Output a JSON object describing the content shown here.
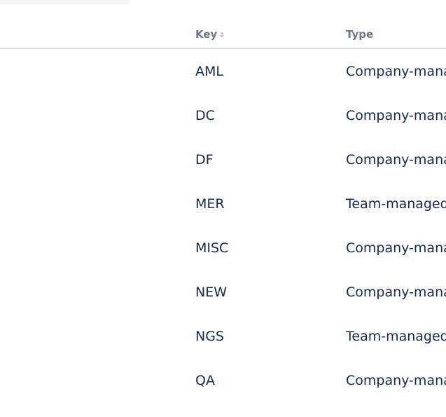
{
  "table": {
    "columns": {
      "key": "Key",
      "type": "Type"
    },
    "rows": [
      {
        "key": "AML",
        "type": "Company-mana"
      },
      {
        "key": "DC",
        "type": "Company-mana"
      },
      {
        "key": "DF",
        "type": "Company-mana"
      },
      {
        "key": "MER",
        "type": "Team-managed"
      },
      {
        "key": "MISC",
        "type": "Company-mana"
      },
      {
        "key": "NEW",
        "type": "Company-mana"
      },
      {
        "key": "NGS",
        "type": "Team-managed"
      },
      {
        "key": "QA",
        "type": "Company-mana"
      }
    ]
  }
}
